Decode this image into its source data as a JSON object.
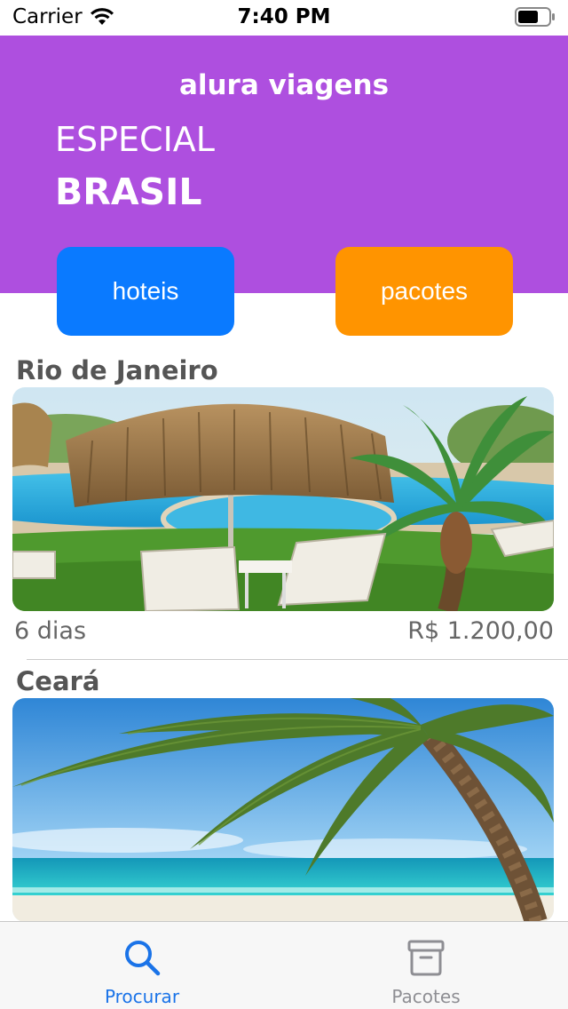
{
  "status_bar": {
    "carrier": "Carrier",
    "time": "7:40 PM"
  },
  "header": {
    "app_title": "alura viagens",
    "special_label": "ESPECIAL",
    "special_name": "BRASIL",
    "background_color": "#ae4fdf"
  },
  "buttons": {
    "hotels_label": "hoteis",
    "hotels_color": "#0a7aff",
    "packages_label": "pacotes",
    "packages_color": "#ff9400"
  },
  "packages": [
    {
      "title": "Rio de Janeiro",
      "image": "pool-with-thatched-umbrella",
      "days": "6 dias",
      "price": "R$ 1.200,00"
    },
    {
      "title": "Ceará",
      "image": "beach-with-palm-tree"
    }
  ],
  "tab_bar": {
    "tabs": [
      {
        "label": "Procurar",
        "icon": "search-icon",
        "active": true
      },
      {
        "label": "Pacotes",
        "icon": "archive-box-icon",
        "active": false
      }
    ],
    "active_color": "#1a73e8",
    "inactive_color": "#8e8e93"
  }
}
